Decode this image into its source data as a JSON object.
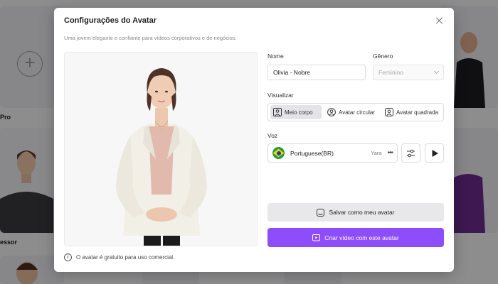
{
  "background": {
    "card_labels": [
      "Pro",
      "essor"
    ]
  },
  "modal": {
    "title": "Configurações do Avatar",
    "description": "Uma jovem elegante e confiante para vídeos corporativos e de negócios.",
    "info_text": "O avatar é gratuito para uso comercial.",
    "name_label": "Nome",
    "name_value": "Olivia - Nobre",
    "gender_label": "Gênero",
    "gender_value": "Feminino",
    "view_label": "Visualizar",
    "view_options": [
      {
        "label": "Meio corpo",
        "icon": "half-body-icon",
        "selected": true
      },
      {
        "label": "Avatar circular",
        "icon": "circle-avatar-icon",
        "selected": false
      },
      {
        "label": "Avatar quadrada",
        "icon": "square-avatar-icon",
        "selected": false
      }
    ],
    "voice_label": "Voz",
    "voice_language": "Portuguese(BR)",
    "voice_name": "Yara",
    "voice_flag": "brazil-flag-icon",
    "save_button": "Salvar como meu avatar",
    "create_button": "Criar vídeo com este avatar"
  },
  "colors": {
    "accent": "#8e4dfa",
    "overlay": "rgba(0,0,0,0.42)"
  }
}
